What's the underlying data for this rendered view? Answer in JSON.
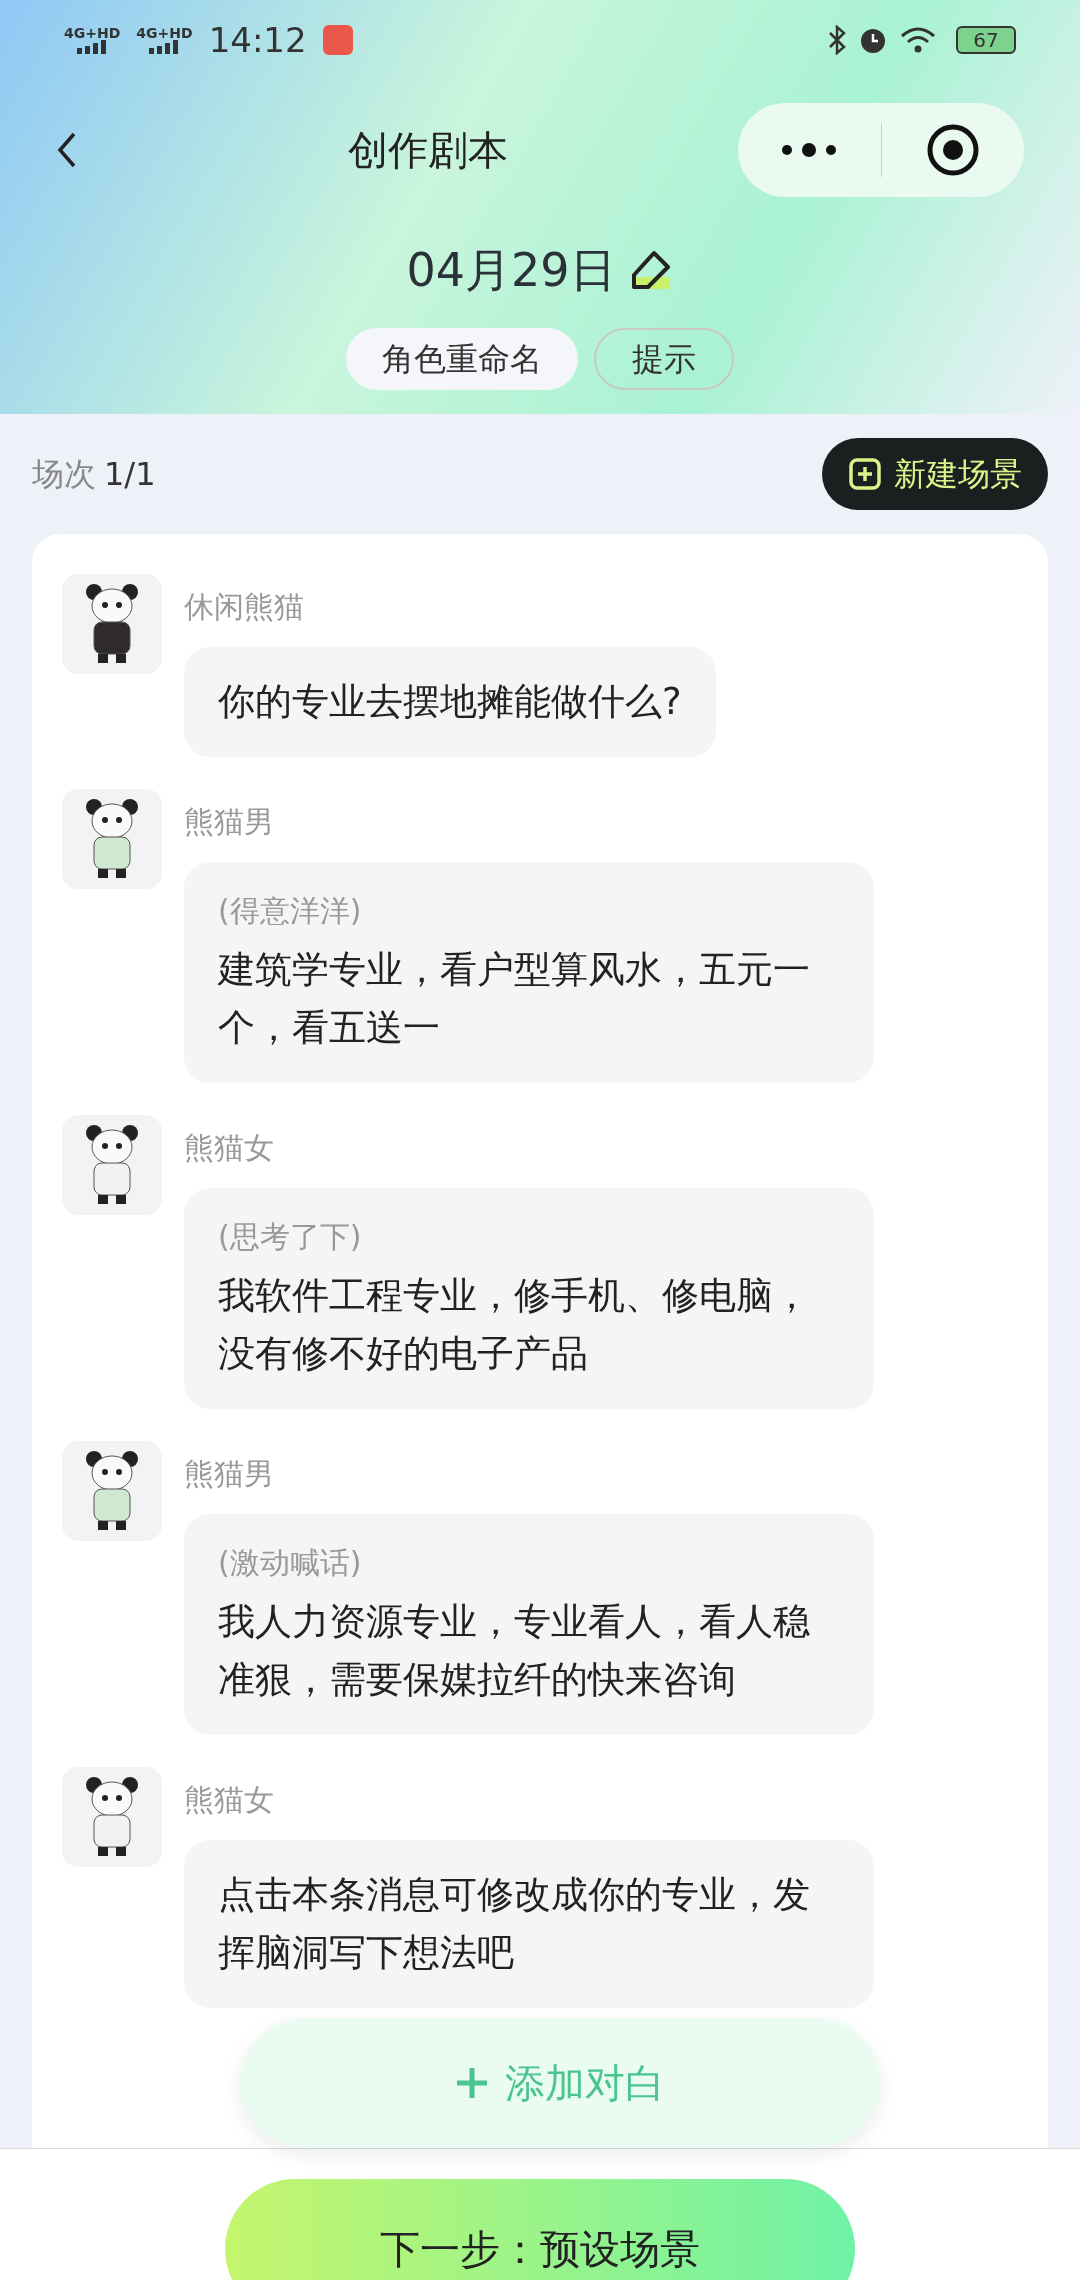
{
  "status_bar": {
    "network_labels": [
      "4G+HD",
      "4G+HD"
    ],
    "time": "14:12",
    "battery": "67"
  },
  "header": {
    "title": "创作剧本"
  },
  "script": {
    "date": "04月29日",
    "buttons": [
      "角色重命名",
      "提示"
    ]
  },
  "scene": {
    "label": "场次",
    "count": "1/1",
    "new_button": "新建场景"
  },
  "messages": [
    {
      "speaker": "休闲熊猫",
      "kind": "dark",
      "lines": [
        "你的专业去摆地摊能做什么?"
      ]
    },
    {
      "speaker": "熊猫男",
      "kind": "green",
      "action": "(得意洋洋)",
      "lines": [
        "建筑学专业，看户型算风水，五元一个，看五送一"
      ]
    },
    {
      "speaker": "熊猫女",
      "kind": "white",
      "action": "(思考了下)",
      "lines": [
        "我软件工程专业，修手机、修电脑，没有修不好的电子产品"
      ]
    },
    {
      "speaker": "熊猫男",
      "kind": "green",
      "action": "(激动喊话)",
      "lines": [
        "我人力资源专业，专业看人，看人稳准狠，需要保媒拉纤的快来咨询"
      ]
    },
    {
      "speaker": "熊猫女",
      "kind": "white",
      "lines": [
        "点击本条消息可修改成你的专业，发挥脑洞写下想法吧"
      ]
    }
  ],
  "add_dialogue": {
    "label": "添加对白"
  },
  "next_button": {
    "label": "下一步：预设场景"
  }
}
